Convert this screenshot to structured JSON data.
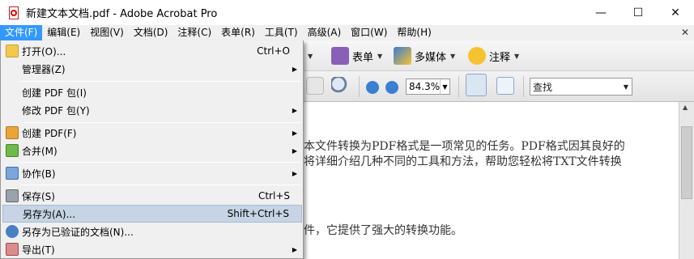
{
  "window": {
    "title": "新建文本文档.pdf - Adobe Acrobat Pro",
    "minimize": "—",
    "maximize": "☐",
    "close": "✕"
  },
  "menubar": {
    "items": [
      "文件(F)",
      "编辑(E)",
      "视图(V)",
      "文档(D)",
      "注释(C)",
      "表单(R)",
      "工具(T)",
      "高级(A)",
      "窗口(W)",
      "帮助(H)"
    ],
    "active_index": 0,
    "mdi_close": "✕"
  },
  "toolbar": {
    "form_label": "表单",
    "multimedia_label": "多媒体",
    "comment_label": "注释",
    "zoom_value": "84.3%",
    "search_placeholder": "查找"
  },
  "document": {
    "lines": [
      "本文件转换为PDF格式是一项常见的任务。PDF格式因其良好的",
      "将详细介绍几种不同的工具和方法，帮助您轻松将TXT文件转换",
      "件，它提供了强大的转换功能。"
    ]
  },
  "file_menu": {
    "items": [
      {
        "label": "打开(O)...",
        "shortcut": "Ctrl+O",
        "submenu": false
      },
      {
        "label": "管理器(Z)",
        "shortcut": "",
        "submenu": true
      },
      {
        "label": "创建 PDF 包(I)",
        "shortcut": "",
        "submenu": false
      },
      {
        "label": "修改 PDF 包(Y)",
        "shortcut": "",
        "submenu": true
      },
      {
        "label": "创建 PDF(F)",
        "shortcut": "",
        "submenu": true
      },
      {
        "label": "合并(M)",
        "shortcut": "",
        "submenu": true
      },
      {
        "label": "协作(B)",
        "shortcut": "",
        "submenu": true
      },
      {
        "label": "保存(S)",
        "shortcut": "Ctrl+S",
        "submenu": false
      },
      {
        "label": "另存为(A)...",
        "shortcut": "Shift+Ctrl+S",
        "submenu": false
      },
      {
        "label": "另存为已验证的文档(N)...",
        "shortcut": "",
        "submenu": false
      },
      {
        "label": "导出(T)",
        "shortcut": "",
        "submenu": true
      }
    ],
    "highlighted_index": 8
  },
  "colors": {
    "menu_active": "#3399ff",
    "menu_highlight": "#c6d4e4"
  }
}
